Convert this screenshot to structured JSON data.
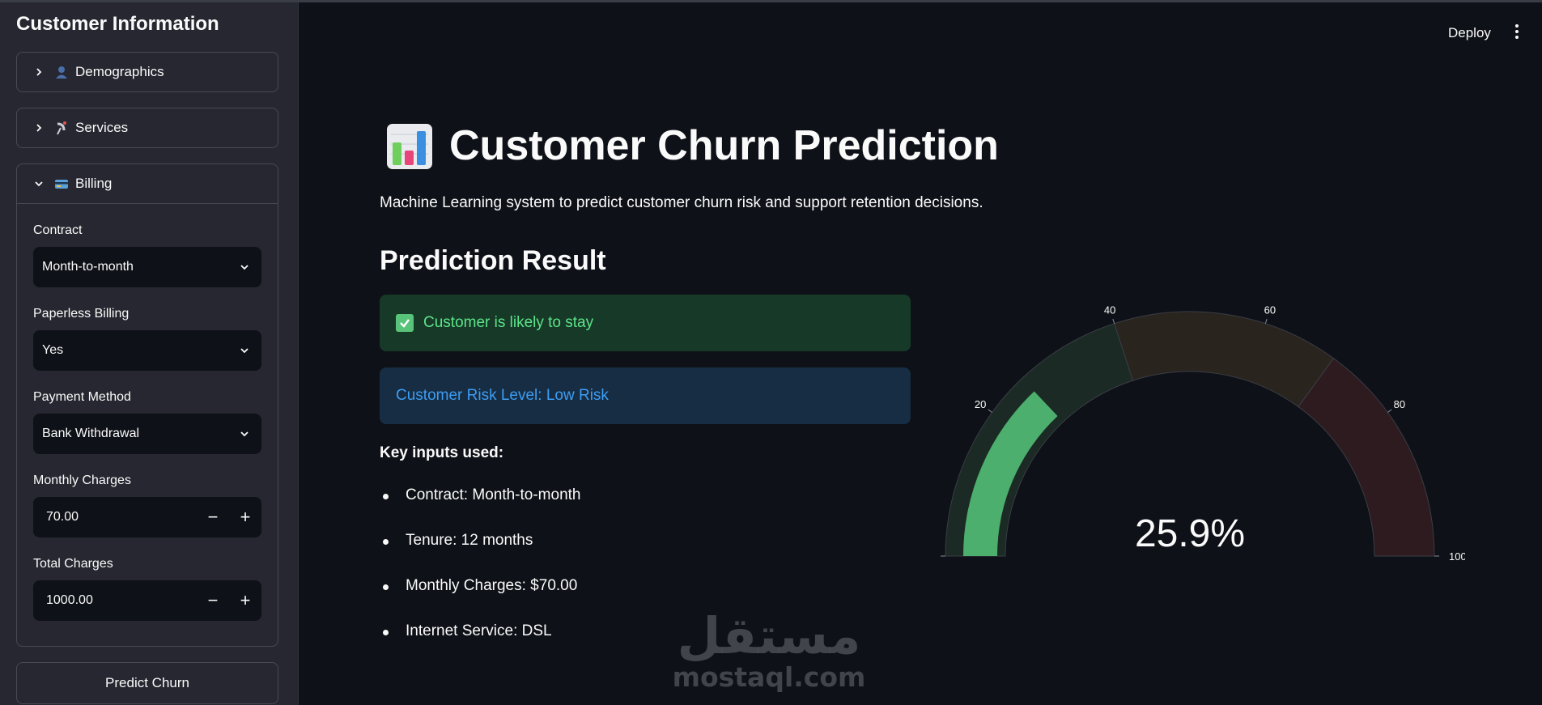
{
  "sidebar": {
    "title": "Customer Information",
    "expanders": [
      {
        "label": "Demographics",
        "icon": "bust-in-silhouette-icon",
        "expanded": false
      },
      {
        "label": "Services",
        "icon": "satellite-antenna-icon",
        "expanded": false
      },
      {
        "label": "Billing",
        "icon": "credit-card-icon",
        "expanded": true
      }
    ],
    "billing": {
      "contract_label": "Contract",
      "contract_value": "Month-to-month",
      "paperless_label": "Paperless Billing",
      "paperless_value": "Yes",
      "payment_label": "Payment Method",
      "payment_value": "Bank Withdrawal",
      "monthly_label": "Monthly Charges",
      "monthly_value": "70.00",
      "total_label": "Total Charges",
      "total_value": "1000.00",
      "minus": "−",
      "plus": "+"
    },
    "predict_button": "Predict Churn"
  },
  "header": {
    "deploy": "Deploy"
  },
  "main": {
    "title": "Customer Churn Prediction",
    "title_icon": "bar-chart-icon",
    "subtitle": "Machine Learning system to predict customer churn risk and support retention decisions.",
    "section_title": "Prediction Result",
    "success_message": "Customer is likely to stay",
    "info_message": "Customer Risk Level: Low Risk",
    "key_inputs_title": "Key inputs used:",
    "key_inputs": [
      "Contract: Month-to-month",
      "Tenure: 12 months",
      "Monthly Charges: $70.00",
      "Internet Service: DSL"
    ]
  },
  "gauge": {
    "value": 25.9,
    "value_text": "25.9%",
    "range": [
      0,
      100
    ],
    "ticks": [
      "0",
      "20",
      "40",
      "60",
      "80",
      "100"
    ],
    "bands": [
      {
        "from": 0,
        "to": 40,
        "color": "#1b2a24"
      },
      {
        "from": 40,
        "to": 70,
        "color": "#2a241f"
      },
      {
        "from": 70,
        "to": 100,
        "color": "#2e1b1f"
      }
    ],
    "bar_color": "#4caf6e"
  },
  "watermark": {
    "arabic": "مستقل",
    "latin": "mostaql.com"
  }
}
